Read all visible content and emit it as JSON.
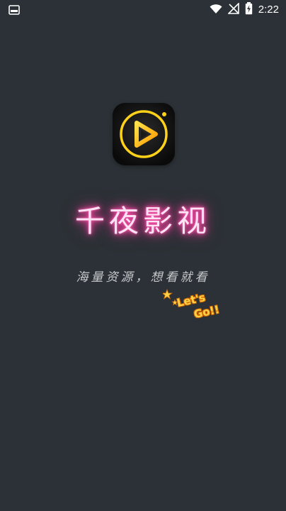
{
  "status_bar": {
    "time": "2:22",
    "icons": [
      "screen-icon",
      "wifi-icon",
      "signal-icon",
      "battery-charging-icon"
    ]
  },
  "brand": {
    "app_name": "千夜影视",
    "slogan": "海量资源，想看就看",
    "badge_line1": "Let's",
    "badge_line2": "Go!!"
  },
  "colors": {
    "background": "#2b3136",
    "icon_gold": "#ffd21a",
    "title_glow": "#ff3aa0",
    "badge_yellow": "#ffd24a",
    "badge_outline": "#d16a00"
  }
}
